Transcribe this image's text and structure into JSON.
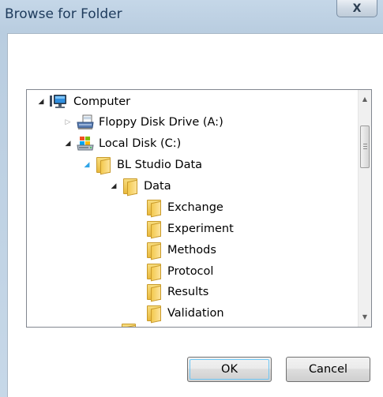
{
  "window": {
    "title": "Browse for Folder",
    "close_symbol": "X"
  },
  "tree": {
    "items": [
      {
        "label": "Computer",
        "icon": "computer-icon",
        "expander": "expanded"
      },
      {
        "label": "Floppy Disk Drive (A:)",
        "icon": "floppy-drive-icon",
        "expander": "collapsed"
      },
      {
        "label": "Local Disk (C:)",
        "icon": "local-disk-icon",
        "expander": "expanded"
      },
      {
        "label": "BL Studio Data",
        "icon": "folder-icon",
        "expander": "expanded-hover"
      },
      {
        "label": "Data",
        "icon": "folder-icon",
        "expander": "expanded"
      },
      {
        "label": "Exchange",
        "icon": "folder-icon",
        "expander": "none"
      },
      {
        "label": "Experiment",
        "icon": "folder-icon",
        "expander": "none"
      },
      {
        "label": "Methods",
        "icon": "folder-icon",
        "expander": "none"
      },
      {
        "label": "Protocol",
        "icon": "folder-icon",
        "expander": "none"
      },
      {
        "label": "Results",
        "icon": "folder-icon",
        "expander": "none"
      },
      {
        "label": "Validation",
        "icon": "folder-icon",
        "expander": "none"
      }
    ]
  },
  "buttons": {
    "ok": "OK",
    "cancel": "Cancel"
  }
}
